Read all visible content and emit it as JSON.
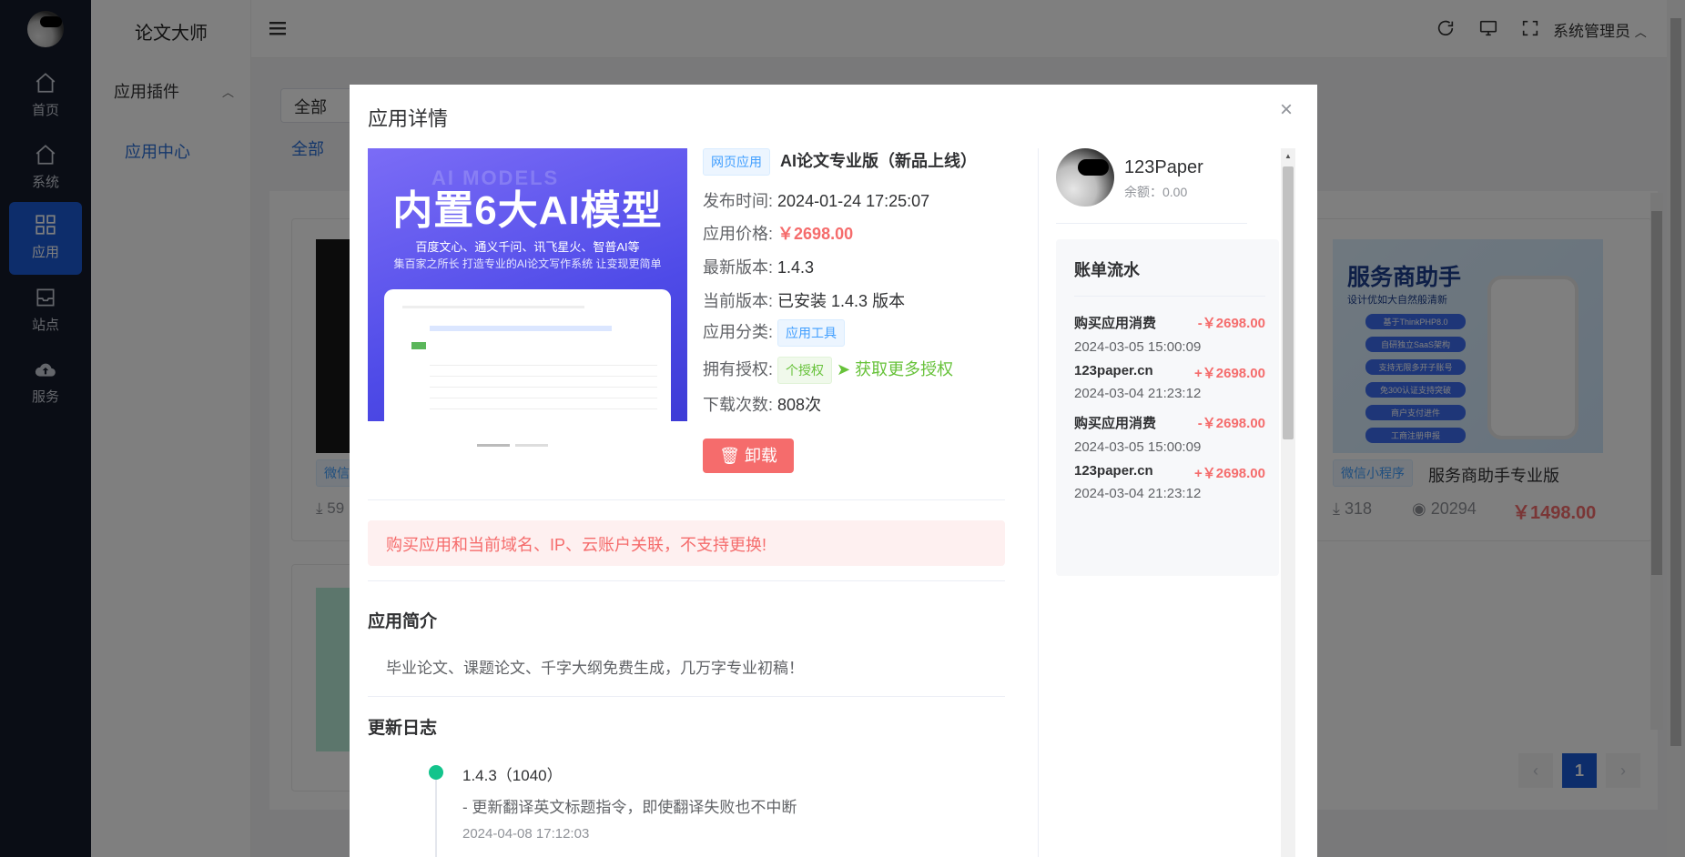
{
  "app": {
    "brand": "论文大师",
    "admin": "系统管理员"
  },
  "rail": [
    {
      "label": "首页",
      "icon": "home-icon"
    },
    {
      "label": "系统",
      "icon": "home-icon"
    },
    {
      "label": "应用",
      "icon": "grid-icon",
      "active": true
    },
    {
      "label": "站点",
      "icon": "inbox-icon"
    },
    {
      "label": "服务",
      "icon": "cloud-upload-icon"
    }
  ],
  "sidebar": {
    "group": "应用插件",
    "link": "应用中心"
  },
  "background": {
    "filter_value": "全部",
    "tab_all": "全部",
    "card1_tag": "微信",
    "card1_downloads": "59",
    "card2_title": "服务商助手",
    "card2_sub": "设计优如大自然般清新",
    "card2_features": [
      "基于ThinkPHP8.0",
      "自研独立SaaS架构",
      "支持无限多开子账号",
      "免300认证支持突破",
      "商户支付进件",
      "工商注册申报"
    ],
    "card2_tag": "微信小程序",
    "card2_name": "服务商助手专业版",
    "card2_downloads": "318",
    "card2_views": "20294",
    "card2_price": "￥1498.00",
    "page_current": "1"
  },
  "modal": {
    "title": "应用详情",
    "banner": {
      "ghost": "AI MODELS",
      "headline": "内置6大AI模型",
      "sub1": "百度文心、通义千问、讯飞星火、智普AI等",
      "sub2": "集百家之所长  打造专业的AI论文写作系统  让变现更简单"
    },
    "type_tag": "网页应用",
    "app_name": "AI论文专业版（新品上线）",
    "rows": {
      "publish_label": "发布时间:",
      "publish_value": "2024-01-24 17:25:07",
      "price_label": "应用价格:",
      "price_value": "￥2698.00",
      "latest_label": "最新版本:",
      "latest_value": "1.4.3",
      "current_label": "当前版本:",
      "current_value": "已安装 1.4.3 版本",
      "category_label": "应用分类:",
      "category_value": "应用工具",
      "license_label": "拥有授权:",
      "license_value": "个授权",
      "license_link": "获取更多授权",
      "downloads_label": "下载次数:",
      "downloads_value": "808次"
    },
    "uninstall": "卸载",
    "alert": "购买应用和当前域名、IP、云账户关联，不支持更换!",
    "intro_title": "应用简介",
    "intro": "毕业论文、课题论文、千字大纲免费生成，几万字专业初稿！",
    "changelog_title": "更新日志",
    "changelog": [
      {
        "version": "1.4.3（1040）",
        "note": "- 更新翻译英文标题指令，即使翻译失败也不中断",
        "date": "2024-04-08 17:12:03"
      }
    ],
    "user": {
      "name": "123Paper",
      "balance": "余额：0.00"
    },
    "bill_title": "账单流水",
    "bills": [
      {
        "name": "购买应用消费",
        "amount": "-￥2698.00",
        "date": "2024-03-05 15:00:09"
      },
      {
        "name": "123paper.cn",
        "amount": "+￥2698.00",
        "date": "2024-03-04 21:23:12"
      },
      {
        "name": "购买应用消费",
        "amount": "-￥2698.00",
        "date": "2024-03-05 15:00:09"
      },
      {
        "name": "123paper.cn",
        "amount": "+￥2698.00",
        "date": "2024-03-04 21:23:12"
      }
    ]
  },
  "colors": {
    "primary": "#1a5ad6",
    "danger": "#f56c6c",
    "success": "#67c23a",
    "rail": "#141a2a"
  }
}
